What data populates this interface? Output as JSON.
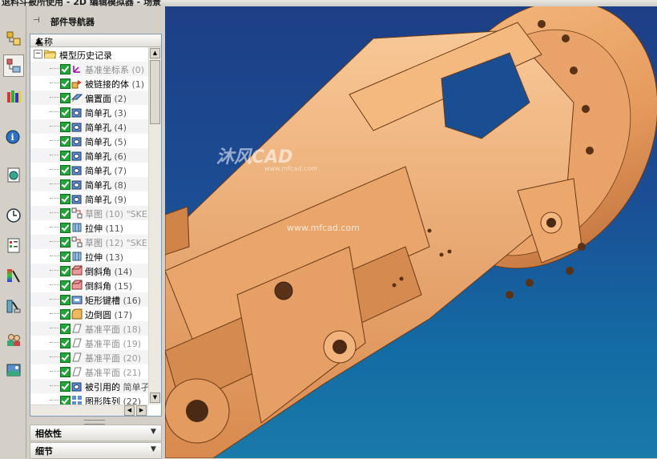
{
  "window": {
    "title": "退料斗被所使用 - 2D 编辑模拟器 - 场景"
  },
  "navigator": {
    "title": "部件导航器",
    "column_name": "名称",
    "root_label": "模型历史记录",
    "rows": [
      {
        "label": "基准坐标系",
        "suffix": "(0)",
        "icon": "datum-csys-icon",
        "dim": true
      },
      {
        "label": "被链接的体",
        "suffix": "(1)",
        "icon": "linked-body-icon",
        "dim": false
      },
      {
        "label": "偏置面",
        "suffix": "(2)",
        "icon": "offset-face-icon",
        "dim": false
      },
      {
        "label": "简单孔",
        "suffix": "(3)",
        "icon": "hole-icon",
        "dim": false
      },
      {
        "label": "简单孔",
        "suffix": "(4)",
        "icon": "hole-icon",
        "dim": false
      },
      {
        "label": "简单孔",
        "suffix": "(5)",
        "icon": "hole-icon",
        "dim": false
      },
      {
        "label": "简单孔",
        "suffix": "(6)",
        "icon": "hole-icon",
        "dim": false
      },
      {
        "label": "简单孔",
        "suffix": "(7)",
        "icon": "hole-icon",
        "dim": false
      },
      {
        "label": "简单孔",
        "suffix": "(8)",
        "icon": "hole-icon",
        "dim": false
      },
      {
        "label": "简单孔",
        "suffix": "(9)",
        "icon": "hole-icon",
        "dim": false
      },
      {
        "label": "草图",
        "suffix": "(10) \"SKE",
        "icon": "sketch-icon",
        "dim": true
      },
      {
        "label": "拉伸",
        "suffix": "(11)",
        "icon": "extrude-icon",
        "dim": false
      },
      {
        "label": "草图",
        "suffix": "(12) \"SKE",
        "icon": "sketch-icon",
        "dim": true
      },
      {
        "label": "拉伸",
        "suffix": "(13)",
        "icon": "extrude-icon",
        "dim": false
      },
      {
        "label": "倒斜角",
        "suffix": "(14)",
        "icon": "chamfer-icon",
        "dim": false
      },
      {
        "label": "倒斜角",
        "suffix": "(15)",
        "icon": "chamfer-icon",
        "dim": false
      },
      {
        "label": "矩形键槽",
        "suffix": "(16)",
        "icon": "slot-icon",
        "dim": false
      },
      {
        "label": "边倒圆",
        "suffix": "(17)",
        "icon": "edge-blend-icon",
        "dim": false
      },
      {
        "label": "基准平面",
        "suffix": "(18)",
        "icon": "datum-plane-icon",
        "dim": true
      },
      {
        "label": "基准平面",
        "suffix": "(19)",
        "icon": "datum-plane-icon",
        "dim": true
      },
      {
        "label": "基准平面",
        "suffix": "(20)",
        "icon": "datum-plane-icon",
        "dim": true
      },
      {
        "label": "基准平面",
        "suffix": "(21)",
        "icon": "datum-plane-icon",
        "dim": true
      },
      {
        "label": "被引用的",
        "suffix": "简单孑",
        "icon": "hole-icon",
        "dim": false
      },
      {
        "label": "图形阵列",
        "suffix": "(22)",
        "icon": "pattern-icon",
        "dim": false
      }
    ],
    "panels": [
      "相依性",
      "细节"
    ]
  },
  "viewport": {
    "watermark": "沐风CAD",
    "watermark_sub": "www.mfcad.com",
    "watermark_url": "www.mfcad.com"
  },
  "resource_bar": [
    "assembly-navigator-icon",
    "part-navigator-icon",
    "reuse-library-icon",
    "info-icon",
    "web-browser-icon",
    "history-icon",
    "system-materials-icon",
    "process-studio-icon",
    "manufacturing-wizard-icon",
    "roles-icon",
    "system-scenes-icon"
  ],
  "colors": {
    "part": "#e9a46a",
    "background_top": "#1d3f86",
    "background_bottom": "#1a7aa9"
  }
}
